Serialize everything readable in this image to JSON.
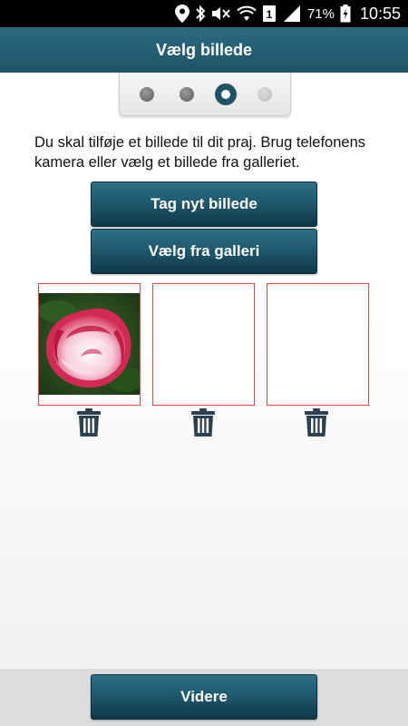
{
  "status_bar": {
    "icons": [
      "location-icon",
      "bluetooth-icon",
      "mute-icon",
      "wifi-icon",
      "sim-1-icon",
      "signal-icon",
      "battery-icon"
    ],
    "battery_percent": "71%",
    "time": "10:55"
  },
  "action_bar": {
    "title": "Vælg billede"
  },
  "stepper": {
    "total_steps": 4,
    "current_step": 3
  },
  "instructions": "Du skal tilføje et billede til dit praj. Brug telefonens kamera eller vælg et billede fra galleriet.",
  "buttons": {
    "take_photo": "Tag nyt billede",
    "choose_gallery": "Vælg fra galleri",
    "next": "Videre"
  },
  "photo_slots": [
    {
      "has_image": true,
      "image": "pink-white-rose"
    },
    {
      "has_image": false
    },
    {
      "has_image": false
    }
  ],
  "colors": {
    "primary": "#1d5467",
    "slot_border": "#e84545",
    "trash_icon": "#2b4050"
  }
}
